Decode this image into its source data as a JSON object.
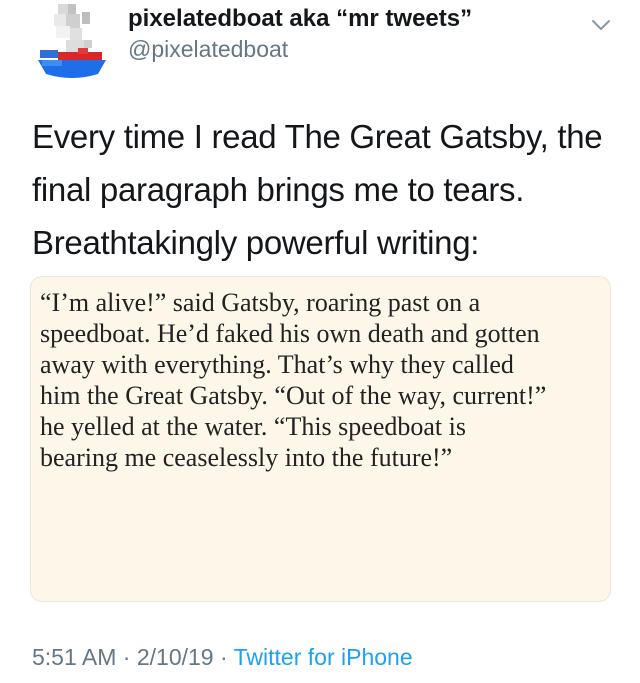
{
  "tweet": {
    "author": {
      "display_name": "pixelatedboat aka “mr tweets”",
      "handle": "@pixelatedboat",
      "avatar_icon": "pixel-boat-avatar-icon"
    },
    "menu_icon": "chevron-down-icon",
    "text": "Every time I read The Great Gatsby, the final paragraph brings me to tears. Breathtakingly powerful writing:",
    "quote_image_text": "“I’m alive!” said Gatsby, roaring past on a\nspeedboat. He’d faked his own death and gotten\naway with everything. That’s why they called\nhim the Great Gatsby. “Out of the way, current!”\nhe yelled at the water. “This speedboat is\nbearing me ceaselessly into the future!”",
    "time": "5:51 AM",
    "date": "2/10/19",
    "separator": "·",
    "source": "Twitter for iPhone"
  },
  "colors": {
    "text_primary": "#14171a",
    "text_secondary": "#657786",
    "link": "#1da1f2",
    "quote_background": "#fdf7ea"
  }
}
